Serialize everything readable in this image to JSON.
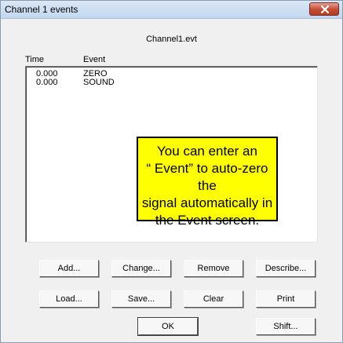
{
  "window": {
    "title": "Channel 1 events"
  },
  "filename": "Channel1.evt",
  "columns": {
    "time": "Time",
    "event": "Event"
  },
  "events": [
    {
      "time": "0.000",
      "event": "ZERO"
    },
    {
      "time": "0.000",
      "event": "SOUND"
    }
  ],
  "callout": {
    "lines": [
      "You can enter an",
      "“ Event” to auto-zero the",
      "signal automatically in",
      "the Event screen."
    ]
  },
  "buttons": {
    "add": "Add...",
    "change": "Change...",
    "remove": "Remove",
    "describe": "Describe...",
    "load": "Load...",
    "save": "Save...",
    "clear": "Clear",
    "print": "Print",
    "ok": "OK",
    "shift": "Shift..."
  }
}
